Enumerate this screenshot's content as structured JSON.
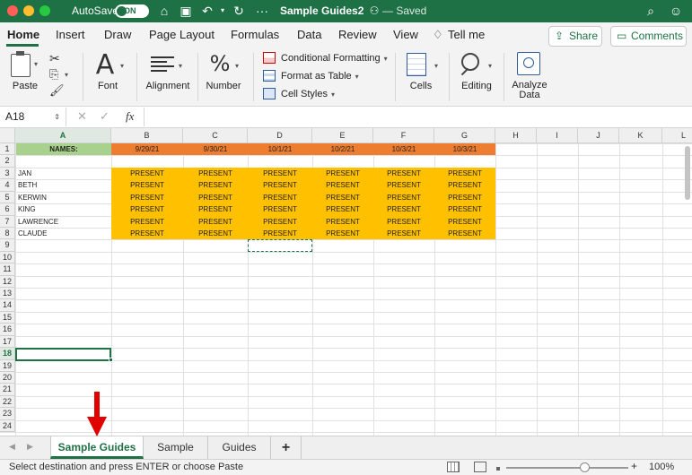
{
  "window": {
    "autosave_label": "AutoSave",
    "autosave_state": "ON",
    "title": "Sample Guides2",
    "status": "— Saved"
  },
  "ribbon_tabs": [
    "Home",
    "Insert",
    "Draw",
    "Page Layout",
    "Formulas",
    "Data",
    "Review",
    "View",
    "Tell me"
  ],
  "share_label": "Share",
  "comments_label": "Comments",
  "ribbon": {
    "paste": "Paste",
    "font": "Font",
    "alignment": "Alignment",
    "number": "Number",
    "conditional_formatting": "Conditional Formatting",
    "format_as_table": "Format as Table",
    "cell_styles": "Cell Styles",
    "cells": "Cells",
    "editing": "Editing",
    "analyze_data": "Analyze Data"
  },
  "formula_bar": {
    "name_box": "A18",
    "fx": "fx",
    "value": ""
  },
  "columns": [
    "A",
    "B",
    "C",
    "D",
    "E",
    "F",
    "G",
    "H",
    "I",
    "J",
    "K",
    "L"
  ],
  "rows": [
    "1",
    "2",
    "3",
    "4",
    "5",
    "6",
    "7",
    "8",
    "9",
    "10",
    "11",
    "12",
    "13",
    "14",
    "15",
    "16",
    "17",
    "18",
    "19",
    "20",
    "21",
    "22",
    "23",
    "24"
  ],
  "sheet": {
    "header_label": "NAMES:",
    "dates": [
      "9/29/21",
      "9/30/21",
      "10/1/21",
      "10/2/21",
      "10/3/21",
      "10/3/21"
    ],
    "names": [
      "JAN",
      "BETH",
      "KERWIN",
      "KING",
      "LAWRENCE",
      "CLAUDE"
    ],
    "status_value": "PRESENT"
  },
  "selected_cell": "A18",
  "sheet_tabs": [
    "Sample Guides",
    "Sample",
    "Guides"
  ],
  "active_sheet": "Sample Guides",
  "add_sheet": "+",
  "status_bar": {
    "message": "Select destination and press ENTER or choose Paste",
    "zoom": "100%"
  },
  "colors": {
    "brand": "#1e7145",
    "names_header": "#a9d18e",
    "date_header": "#f4b183",
    "present_fill": "#ffc000",
    "annotation_arrow": "#e00000"
  }
}
